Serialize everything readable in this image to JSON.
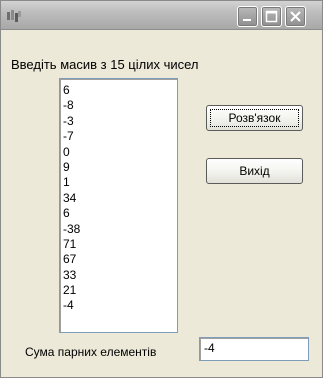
{
  "window": {
    "title": "",
    "icon": "app-icon",
    "controls": [
      "minimize-icon",
      "maximize-icon",
      "close-icon"
    ]
  },
  "prompt_label": "Введіть масив з 15 цілих чисел",
  "array_list": {
    "items": [
      "6",
      "-8",
      "-3",
      "-7",
      "0",
      "9",
      "1",
      "34",
      "6",
      "-38",
      "71",
      "67",
      "33",
      "21",
      "-4"
    ]
  },
  "buttons": {
    "solve_label": "Розв'язок",
    "exit_label": "Вихід"
  },
  "result": {
    "label": "Сума парних елементів",
    "value": "-4"
  },
  "colors": {
    "window_bg": "#ece9d8",
    "titlebar": "#bdbdbd",
    "field_border": "#7f9db9"
  }
}
